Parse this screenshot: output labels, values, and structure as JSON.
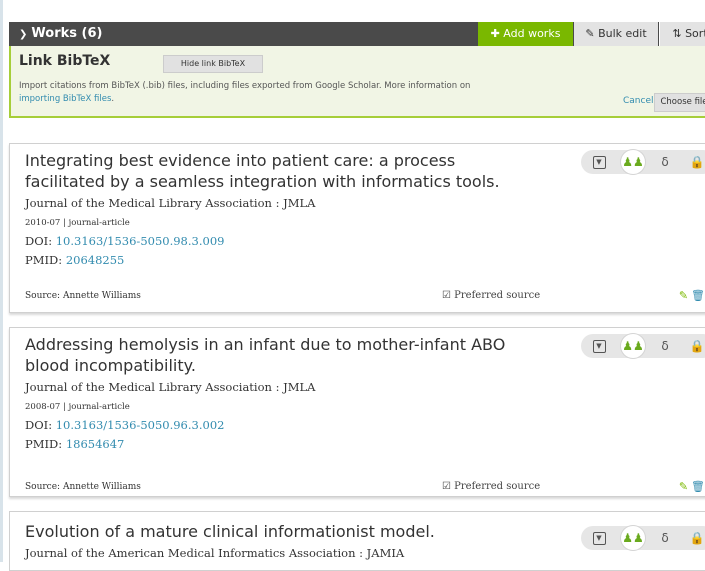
{
  "header": {
    "title": "Works (6)",
    "add_label": "Add works",
    "bulk_label": "Bulk edit",
    "sort_label": "Sort"
  },
  "bibtex": {
    "title": "Link BibTeX",
    "hide_label": "Hide link BibTeX",
    "desc_prefix": "Import citations from BibTeX (.bib) files, including files exported from Google Scholar. More information on",
    "desc_link": "importing BibTeX files",
    "desc_suffix": ".",
    "cancel_label": "Cancel",
    "choose_label": "Choose file"
  },
  "works": [
    {
      "title": "Integrating best evidence into patient care: a process facilitated by a seamless integration with informatics tools.",
      "journal": "Journal of the Medical Library Association : JMLA",
      "date_type": "2010-07 | journal-article",
      "doi_label": "DOI:",
      "doi": "10.3163/1536-5050.98.3.009",
      "pmid_label": "PMID:",
      "pmid": "20648255",
      "source": "Source: Annette Williams",
      "preferred": "Preferred source"
    },
    {
      "title": "Addressing hemolysis in an infant due to mother-infant ABO blood incompatibility.",
      "journal": "Journal of the Medical Library Association : JMLA",
      "date_type": "2008-07 | journal-article",
      "doi_label": "DOI:",
      "doi": "10.3163/1536-5050.96.3.002",
      "pmid_label": "PMID:",
      "pmid": "18654647",
      "source": "Source: Annette Williams",
      "preferred": "Preferred source"
    },
    {
      "title": "Evolution of a mature clinical informationist model.",
      "journal": "Journal of the American Medical Informatics Association : JAMIA"
    }
  ],
  "colors": {
    "header_bg": "#4a4a4a",
    "add_bg": "#7ab800",
    "link": "#338caf",
    "panel_border": "#a6ce39"
  },
  "icons": [
    "chevron-down-icon",
    "plus-icon",
    "pencil-icon",
    "sort-icon",
    "checkbox-icon",
    "trash-icon",
    "privacy-me-icon",
    "privacy-trusted-icon",
    "privacy-limited-icon",
    "privacy-private-icon"
  ]
}
